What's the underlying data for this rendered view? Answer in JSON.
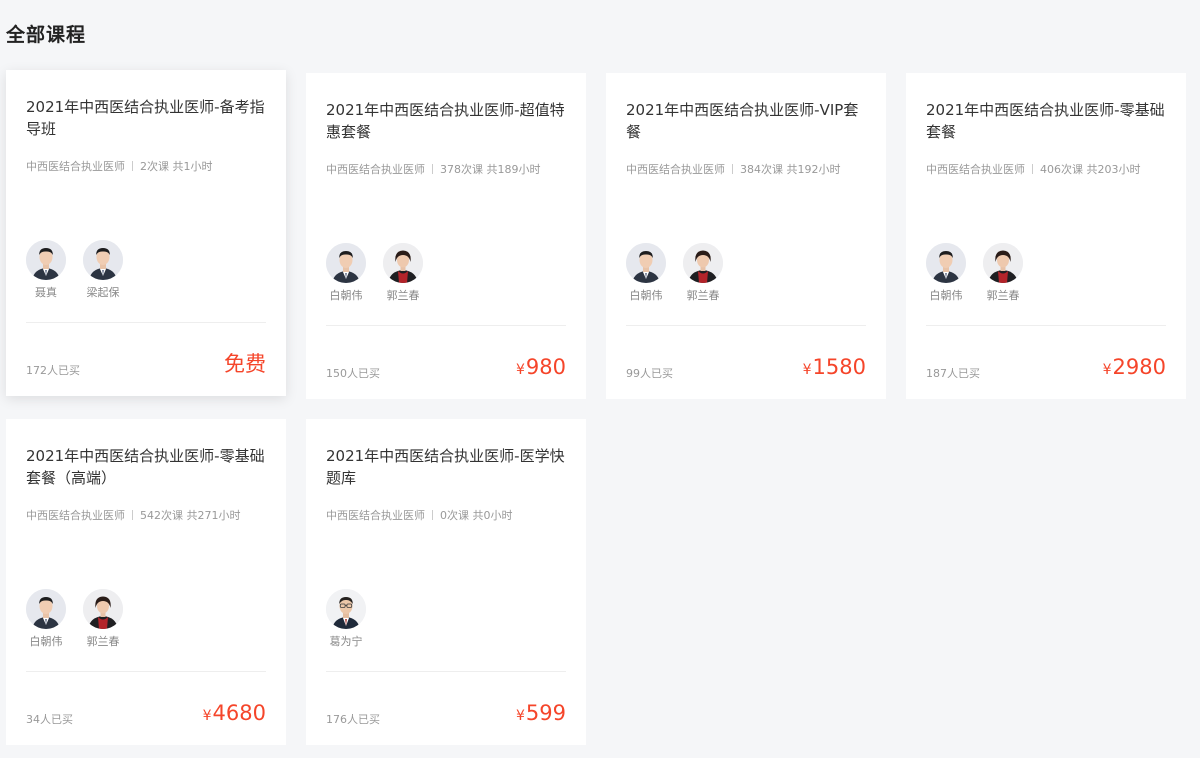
{
  "section": {
    "title": "全部课程"
  },
  "courses": [
    {
      "title": "2021年中西医结合执业医师-备考指导班",
      "category": "中西医结合执业医师",
      "stats": "2次课 共1小时",
      "teachers": [
        {
          "name": "聂真",
          "avatar": "man-suit-icon"
        },
        {
          "name": "梁起保",
          "avatar": "man-suit-icon"
        }
      ],
      "buyers": "172人已买",
      "currency": "",
      "price": "免费"
    },
    {
      "title": "2021年中西医结合执业医师-超值特惠套餐",
      "category": "中西医结合执业医师",
      "stats": "378次课 共189小时",
      "teachers": [
        {
          "name": "白朝伟",
          "avatar": "man-suit-icon"
        },
        {
          "name": "郭兰春",
          "avatar": "woman-red-icon"
        }
      ],
      "buyers": "150人已买",
      "currency": "¥",
      "price": "980"
    },
    {
      "title": "2021年中西医结合执业医师-VIP套餐",
      "category": "中西医结合执业医师",
      "stats": "384次课 共192小时",
      "teachers": [
        {
          "name": "白朝伟",
          "avatar": "man-suit-icon"
        },
        {
          "name": "郭兰春",
          "avatar": "woman-red-icon"
        }
      ],
      "buyers": "99人已买",
      "currency": "¥",
      "price": "1580"
    },
    {
      "title": "2021年中西医结合执业医师-零基础套餐",
      "category": "中西医结合执业医师",
      "stats": "406次课 共203小时",
      "teachers": [
        {
          "name": "白朝伟",
          "avatar": "man-suit-icon"
        },
        {
          "name": "郭兰春",
          "avatar": "woman-red-icon"
        }
      ],
      "buyers": "187人已买",
      "currency": "¥",
      "price": "2980"
    },
    {
      "title": "2021年中西医结合执业医师-零基础套餐（高端）",
      "category": "中西医结合执业医师",
      "stats": "542次课 共271小时",
      "teachers": [
        {
          "name": "白朝伟",
          "avatar": "man-suit-icon"
        },
        {
          "name": "郭兰春",
          "avatar": "woman-red-icon"
        }
      ],
      "buyers": "34人已买",
      "currency": "¥",
      "price": "4680"
    },
    {
      "title": "2021年中西医结合执业医师-医学快题库",
      "category": "中西医结合执业医师",
      "stats": "0次课 共0小时",
      "teachers": [
        {
          "name": "葛为宁",
          "avatar": "man-glasses-icon"
        }
      ],
      "buyers": "176人已买",
      "currency": "¥",
      "price": "599"
    }
  ],
  "colors": {
    "price": "#f5452a",
    "background": "#f5f6f8",
    "card": "#ffffff"
  }
}
